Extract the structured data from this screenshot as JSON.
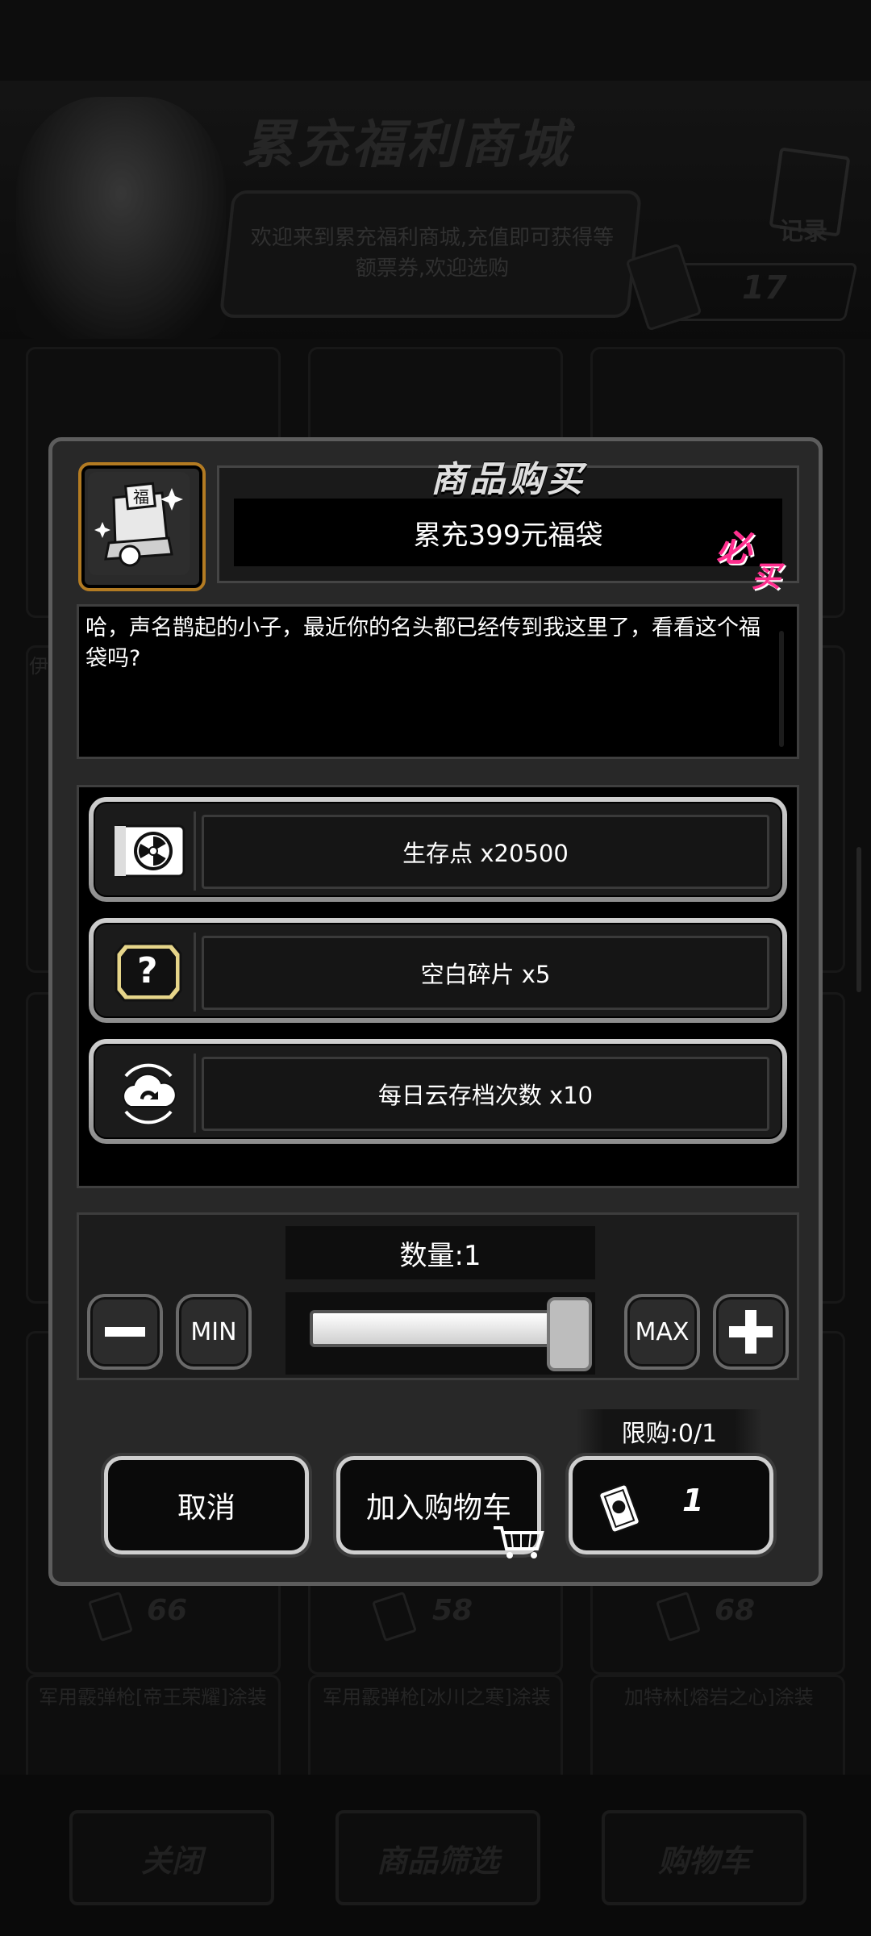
{
  "background": {
    "store_title": "累充福利商城",
    "welcome_text": "欢迎来到累充福利商城,充值即可获得等额票券,欢迎选购",
    "record_label": "记录",
    "ticket_balance": "17",
    "price_row": [
      "66",
      "58",
      "68"
    ],
    "item_titles": [
      "军用霰弹枪[帝王荣耀]涂装",
      "军用霰弹枪[冰川之寒]涂装",
      "加特林[熔岩之心]涂装"
    ],
    "side_label": "伊",
    "footer": {
      "close": "关闭",
      "filter": "商品筛选",
      "cart": "购物车"
    }
  },
  "dialog": {
    "title": "商品购买",
    "product_name": "累充399元福袋",
    "badge": [
      "必",
      "买"
    ],
    "description": "哈，声名鹊起的小子，最近你的名头都已经传到我这里了，看看这个福袋吗?",
    "rewards": [
      {
        "label": "生存点 x20500",
        "icon": "radiation-card-icon"
      },
      {
        "label": "空白碎片 x5",
        "icon": "question-fragment-icon"
      },
      {
        "label": "每日云存档次数 x10",
        "icon": "cloud-sync-icon"
      }
    ],
    "quantity": {
      "label": "数量:1",
      "min_label": "MIN",
      "max_label": "MAX",
      "value": 1,
      "max": 1
    },
    "limit": "限购:0/1",
    "buttons": {
      "cancel": "取消",
      "add_to_cart": "加入购物车",
      "price": "1"
    }
  }
}
